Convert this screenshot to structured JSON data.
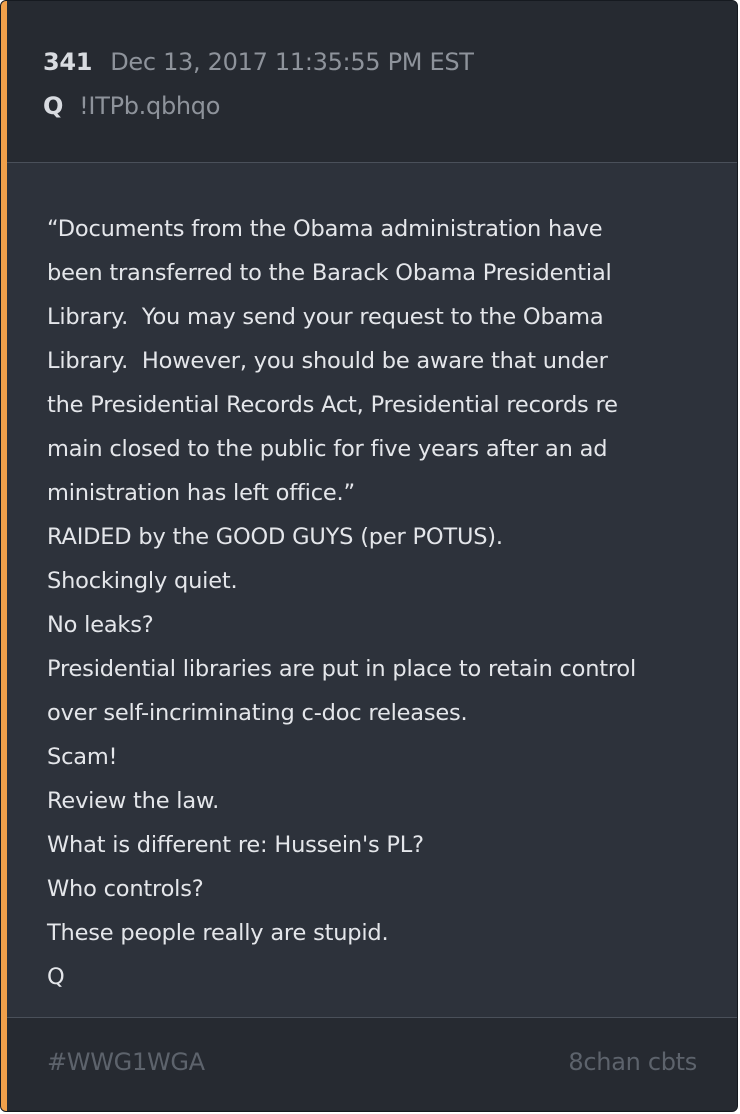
{
  "post": {
    "number": "341",
    "timestamp": "Dec 13, 2017 11:35:55 PM EST",
    "author": "Q",
    "tripcode": "!ITPb.qbhqo"
  },
  "body": {
    "lines": [
      "“Documents from the Obama administration have",
      "been transferred to the Barack Obama Presidential",
      "Library.  You may send your request to the Obama",
      "Library.  However, you should be aware that under",
      "the Presidential Records Act, Presidential records re",
      "main closed to the public for five years after an ad",
      "ministration has left office.”",
      "RAIDED by the GOOD GUYS (per POTUS).",
      "Shockingly quiet.",
      "No leaks?",
      "Presidential libraries are put in place to retain control",
      "over self-incriminating c-doc releases.",
      "Scam!",
      "Review the law.",
      "What is different re: Hussein's PL?",
      "Who controls?",
      "These people really are stupid.",
      "Q"
    ]
  },
  "footer": {
    "tag": "#WWG1WGA",
    "source": "8chan cbts"
  },
  "colors": {
    "accent": "#f0a04b",
    "card_background": "#2d323b",
    "header_background": "#262a31"
  }
}
